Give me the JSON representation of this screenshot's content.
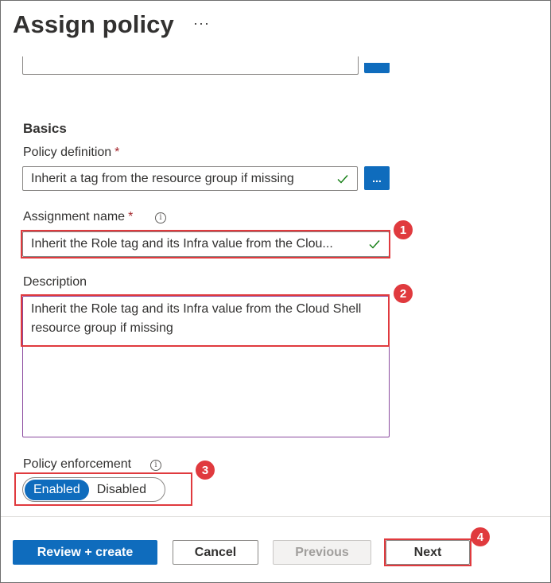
{
  "header": {
    "title": "Assign policy",
    "more_label": "···"
  },
  "basics": {
    "section_title": "Basics",
    "policy_definition": {
      "label": "Policy definition",
      "required_mark": "*",
      "value": "Inherit a tag from the resource group if missing",
      "browse_label": "..."
    },
    "assignment_name": {
      "label": "Assignment name",
      "required_mark": "*",
      "info_icon": "i",
      "value": "Inherit the Role tag and its Infra value from the Clou..."
    },
    "description": {
      "label": "Description",
      "value": "Inherit the Role tag and its Infra value from the Cloud Shell resource group if missing"
    },
    "policy_enforcement": {
      "label": "Policy enforcement",
      "info_icon": "i",
      "options": [
        "Enabled",
        "Disabled"
      ],
      "selected": "Enabled"
    }
  },
  "callouts": [
    "1",
    "2",
    "3",
    "4"
  ],
  "footer": {
    "review_create_label": "Review + create",
    "cancel_label": "Cancel",
    "previous_label": "Previous",
    "next_label": "Next"
  },
  "colors": {
    "primary": "#0f6cbd",
    "highlight": "#e03a3e",
    "success_check": "#107c10",
    "required": "#a4262c"
  },
  "icons": {
    "more": "ellipsis-icon",
    "check": "checkmark-icon",
    "info": "info-icon"
  }
}
